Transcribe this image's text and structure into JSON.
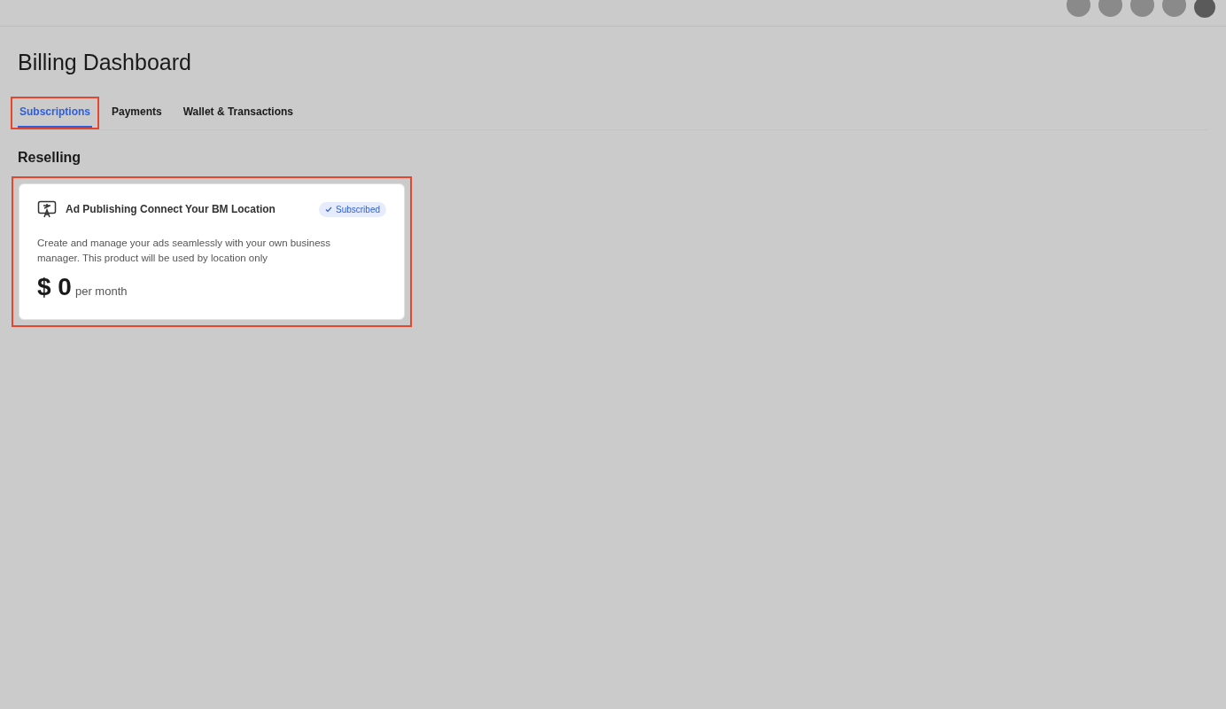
{
  "header": {
    "avatars": [
      {
        "kind": "circle"
      },
      {
        "kind": "circle"
      },
      {
        "kind": "circle"
      },
      {
        "kind": "circle"
      },
      {
        "kind": "photo"
      }
    ]
  },
  "page": {
    "title": "Billing Dashboard"
  },
  "tabs": [
    {
      "label": "Subscriptions",
      "selected": true,
      "highlighted": true
    },
    {
      "label": "Payments",
      "selected": false,
      "highlighted": false
    },
    {
      "label": "Wallet & Transactions",
      "selected": false,
      "highlighted": false
    }
  ],
  "section": {
    "title": "Reselling"
  },
  "cards": [
    {
      "title": "Ad Publishing Connect Your BM Location",
      "badge": "Subscribed",
      "subscribed": true,
      "highlighted": true,
      "description": "Create and manage your ads seamlessly with your own business manager. This product will be used by location only",
      "price": "$ 0",
      "period": "per month"
    }
  ]
}
